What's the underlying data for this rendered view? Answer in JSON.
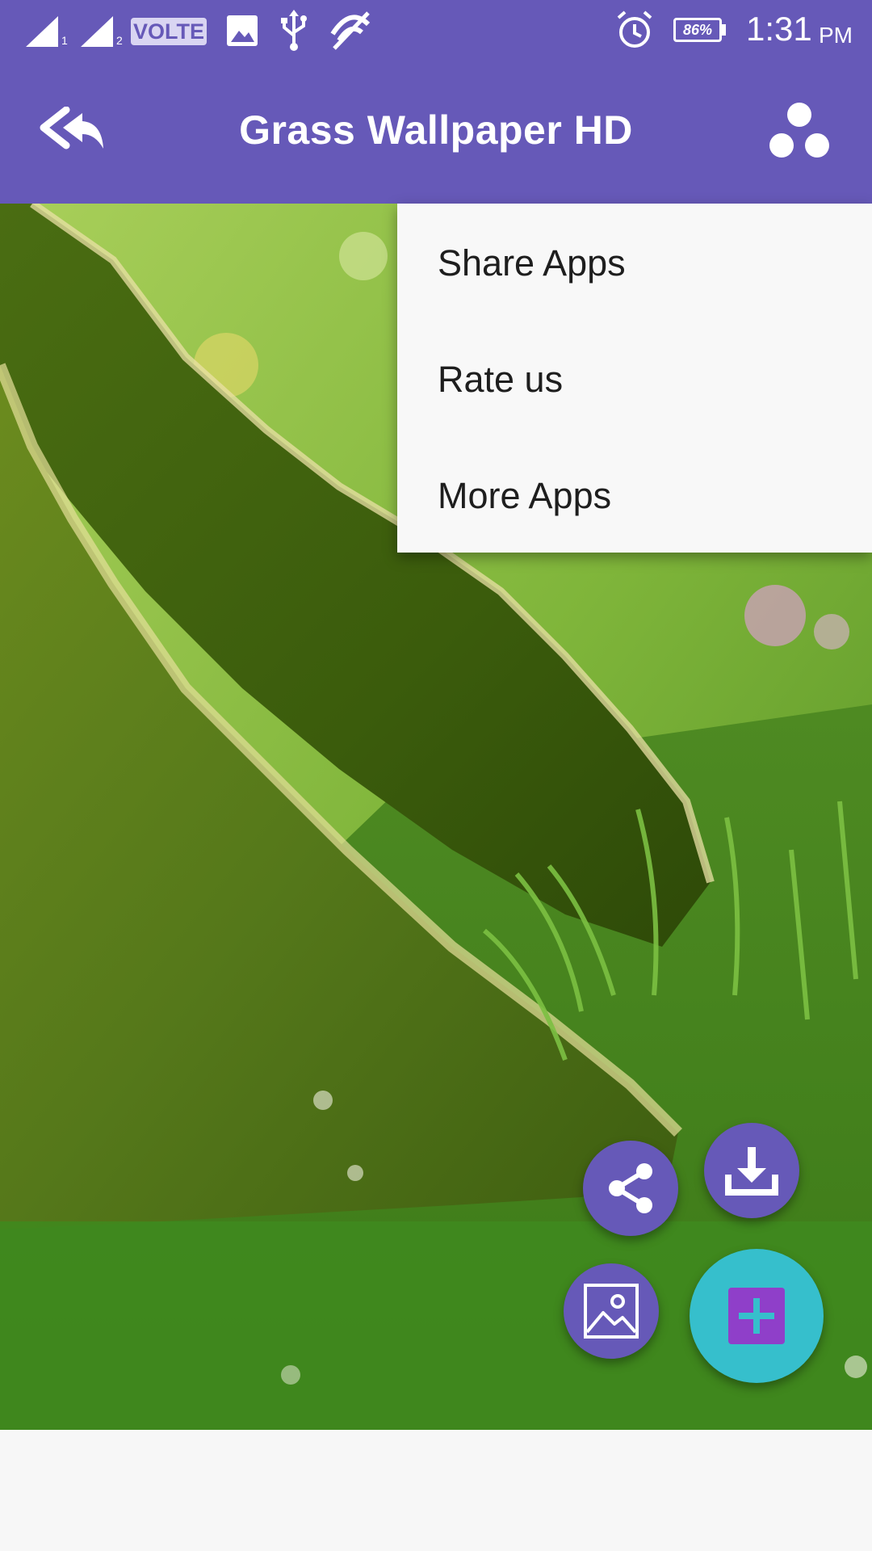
{
  "status_bar": {
    "network_label": "VOLTE",
    "sim1_label": "1",
    "sim2_label": "2",
    "battery": "86%",
    "time": "1:31",
    "ampm": "PM",
    "icons": [
      "signal-sim1-icon",
      "signal-sim2-icon",
      "volte-icon",
      "image-notification-icon",
      "usb-icon",
      "no-wifi-icon",
      "alarm-icon",
      "battery-icon"
    ]
  },
  "app_bar": {
    "title": "Grass Wallpaper HD",
    "back_icon": "reply-all-icon",
    "menu_icon": "three-dots-icon"
  },
  "menu": {
    "items": [
      "Share Apps",
      "Rate us",
      "More Apps"
    ]
  },
  "fabs": {
    "share_icon": "share-icon",
    "download_icon": "download-icon",
    "set_wallpaper_icon": "image-icon",
    "main_icon": "plus-icon",
    "colors": {
      "small": "#6659b8",
      "main": "#36bfcc",
      "plus_box": "#8f3fc9"
    }
  },
  "theme": {
    "primary": "#6659b8"
  }
}
